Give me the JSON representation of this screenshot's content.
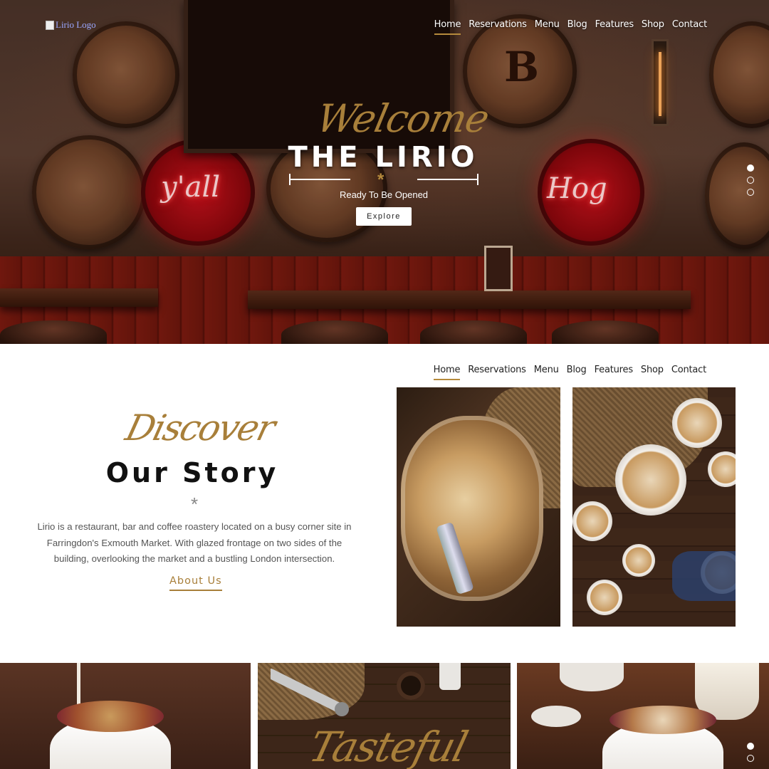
{
  "logo": {
    "alt": "Lirio Logo"
  },
  "nav": {
    "items": [
      "Home",
      "Reservations",
      "Menu",
      "Blog",
      "Features",
      "Shop",
      "Contact"
    ],
    "active": "Home"
  },
  "hero": {
    "script": "Welcome",
    "title": "THE LIRIO",
    "star": "*",
    "subtitle": "Ready To Be Opened",
    "button": "Explore",
    "neon_left": "y'all",
    "neon_right": "Hog",
    "barrel_letter": "B",
    "slides": 3,
    "active_slide": 1
  },
  "story": {
    "script": "Discover",
    "title": "Our Story",
    "star": "*",
    "text": "Lirio is a restaurant, bar and coffee roastery located on a busy corner site in Farringdon's Exmouth Market. With glazed frontage on two sides of the building, overlooking the market and a bustling London intersection.",
    "link": "About Us"
  },
  "gallery": {
    "script": "Tasteful",
    "slides": 2,
    "active_slide": 1
  },
  "colors": {
    "accent": "#a87f3a",
    "hero_dark": "#2a1610",
    "neon_red": "#c2121b"
  }
}
